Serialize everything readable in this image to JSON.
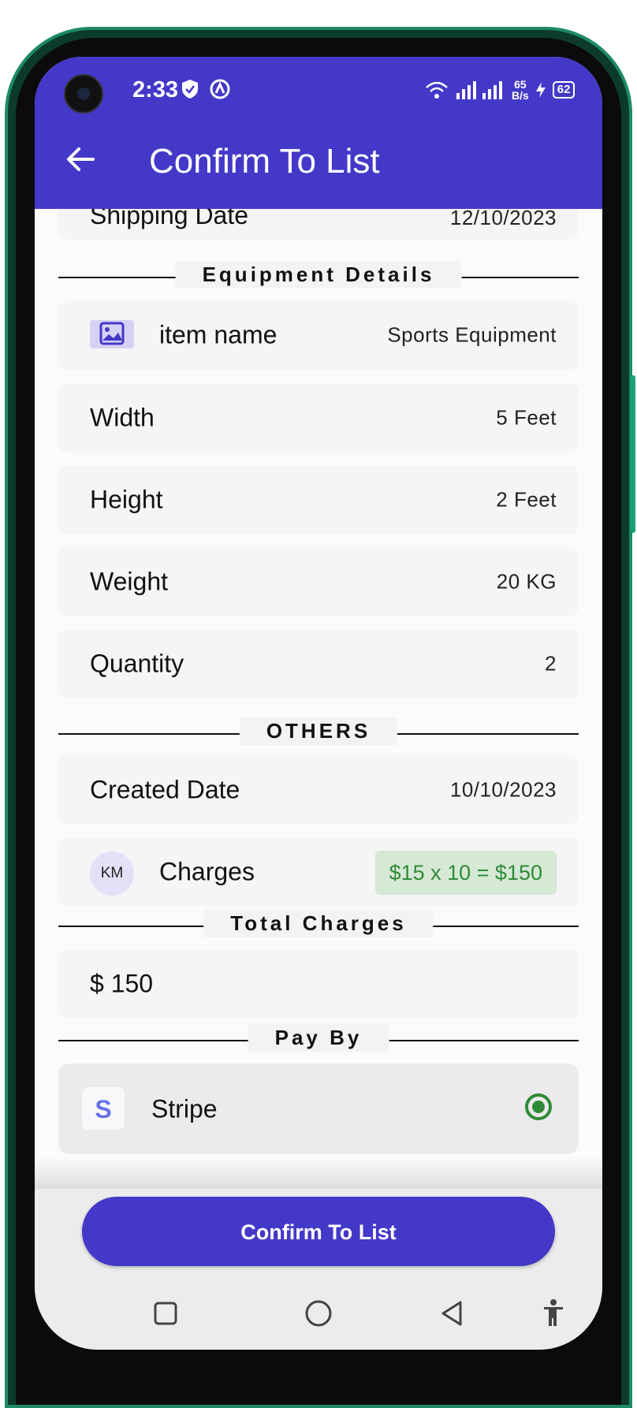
{
  "status_bar": {
    "time": "2:33",
    "net_speed_value": "65",
    "net_speed_unit": "B/s",
    "battery": "62"
  },
  "app_bar": {
    "title": "Confirm To List"
  },
  "top_card": {
    "label": "Shipping Date",
    "value": "12/10/2023"
  },
  "sections": {
    "equipment": "Equipment Details",
    "others": "OTHERS",
    "total": "Total Charges",
    "pay_by": "Pay By"
  },
  "equipment": {
    "item_name_label": "item name",
    "item_name_value": "Sports Equipment",
    "width_label": "Width",
    "width_value": "5 Feet",
    "height_label": "Height",
    "height_value": "2 Feet",
    "weight_label": "Weight",
    "weight_value": "20 KG",
    "quantity_label": "Quantity",
    "quantity_value": "2"
  },
  "others": {
    "created_label": "Created Date",
    "created_value": "10/10/2023",
    "charges_avatar": "KM",
    "charges_label": "Charges",
    "charges_value": "$15 x 10 = $150"
  },
  "total": {
    "value": "$ 150"
  },
  "payment": {
    "method_logo": "S",
    "method_label": "Stripe",
    "selected": true
  },
  "footer": {
    "confirm_label": "Confirm To List"
  },
  "colors": {
    "primary": "#4438c8",
    "success": "#2f8a38",
    "success_bg": "#d5e9d4"
  },
  "icons": [
    "back-arrow-icon",
    "image-icon",
    "stripe-icon",
    "radio-selected-icon",
    "square-nav-icon",
    "circle-nav-icon",
    "triangle-back-nav-icon",
    "accessibility-icon",
    "wifi-icon",
    "signal-icon",
    "shield-icon",
    "battery-icon"
  ]
}
